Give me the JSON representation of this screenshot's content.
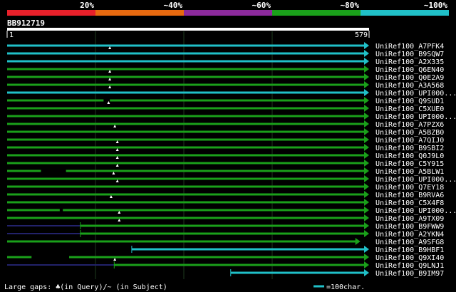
{
  "chart_data": {
    "type": "bar",
    "query_id": "BB912719",
    "query_length": 579,
    "scale_start_label": "1",
    "scale_end_label": "579",
    "identity_scale": [
      {
        "label": "20%",
        "color": "#e8202a"
      },
      {
        "label": "~40%",
        "color": "#e86a10"
      },
      {
        "label": "~60%",
        "color": "#8c2a9c"
      },
      {
        "label": "~80%",
        "color": "#1aa01a"
      },
      {
        "label": "~100%",
        "color": "#20c0c8"
      }
    ],
    "hits": [
      {
        "name": "UniRef100_A7PFK4",
        "color": "#20c0c8",
        "start": 1,
        "end": 579,
        "gap": 165,
        "gap_pos": [
          170,
          172
        ]
      },
      {
        "name": "UniRef100_B9SQW7",
        "color": "#20c0c8",
        "start": 1,
        "end": 579,
        "gap": null
      },
      {
        "name": "UniRef100_A2X335",
        "color": "#20c0c8",
        "start": 1,
        "end": 579,
        "gap": null
      },
      {
        "name": "UniRef100_Q6EN40",
        "color": "#1aa01a",
        "start": 1,
        "end": 579,
        "gap": 165
      },
      {
        "name": "UniRef100_Q0E2A9",
        "color": "#1aa01a",
        "start": 1,
        "end": 579,
        "gap": 165
      },
      {
        "name": "UniRef100_A3A568",
        "color": "#1aa01a",
        "start": 1,
        "end": 579,
        "gap": 165
      },
      {
        "name": "UniRef100_UPI000...",
        "color": "#20c0c8",
        "start": 1,
        "end": 579,
        "gap": null
      },
      {
        "name": "UniRef100_Q9SUD1",
        "color": "#1aa01a",
        "start": 1,
        "end": 579,
        "gap": 163,
        "black": [
          155,
          165
        ]
      },
      {
        "name": "UniRef100_C5XUE0",
        "color": "#1aa01a",
        "start": 1,
        "end": 579,
        "gap": null
      },
      {
        "name": "UniRef100_UPI000...",
        "color": "#1aa01a",
        "start": 1,
        "end": 579,
        "gap": null
      },
      {
        "name": "UniRef100_A7PZX6",
        "color": "#1aa01a",
        "start": 1,
        "end": 579,
        "gap": 173
      },
      {
        "name": "UniRef100_A5BZB0",
        "color": "#1aa01a",
        "start": 1,
        "end": 579,
        "gap": null
      },
      {
        "name": "UniRef100_A7QIJ0",
        "color": "#1aa01a",
        "start": 1,
        "end": 579,
        "gap": 177
      },
      {
        "name": "UniRef100_B9SBI2",
        "color": "#1aa01a",
        "start": 1,
        "end": 579,
        "gap": 177
      },
      {
        "name": "UniRef100_Q0J9L0",
        "color": "#1aa01a",
        "start": 1,
        "end": 579,
        "gap": 177
      },
      {
        "name": "UniRef100_C5Y915",
        "color": "#1aa01a",
        "start": 1,
        "end": 579,
        "gap": 177
      },
      {
        "name": "UniRef100_A5BLW1",
        "color": "#1aa01a",
        "start": 1,
        "end": 579,
        "gap": 171,
        "black": [
          55,
          95
        ]
      },
      {
        "name": "UniRef100_UPI000...",
        "color": "#1aa01a",
        "start": 1,
        "end": 579,
        "gap": 177
      },
      {
        "name": "UniRef100_Q7EY18",
        "color": "#1aa01a",
        "start": 1,
        "end": 579,
        "gap": null
      },
      {
        "name": "UniRef100_B9RVA6",
        "color": "#1aa01a",
        "start": 1,
        "end": 579,
        "gap": 167
      },
      {
        "name": "UniRef100_C5X4F8",
        "color": "#1aa01a",
        "start": 1,
        "end": 579,
        "gap": null
      },
      {
        "name": "UniRef100_UPI000...",
        "color": "#1aa01a",
        "start": 1,
        "end": 579,
        "gap": 180,
        "black": [
          85,
          90
        ]
      },
      {
        "name": "UniRef100_A9TX09",
        "color": "#1aa01a",
        "start": 1,
        "end": 579,
        "gap": 180
      },
      {
        "name": "UniRef100_B9FWW9",
        "color": "#1aa01a",
        "start": 118,
        "end": 579,
        "gap": null,
        "navy": [
          1,
          118
        ]
      },
      {
        "name": "UniRef100_A2YKN4",
        "color": "#1aa01a",
        "start": 118,
        "end": 579,
        "gap": null,
        "navy": [
          1,
          118
        ]
      },
      {
        "name": "UniRef100_A9SFG8",
        "color": "#1aa01a",
        "start": 1,
        "end": 565,
        "gap": null
      },
      {
        "name": "UniRef100_B9HBF1",
        "color": "#20c0c8",
        "start": 200,
        "end": 579,
        "gap": null
      },
      {
        "name": "UniRef100_Q9XI40",
        "color": "#1aa01a",
        "start": 1,
        "end": 579,
        "gap": 173,
        "black": [
          40,
          100
        ]
      },
      {
        "name": "UniRef100_Q9LNJ1",
        "color": "#1aa01a",
        "start": 172,
        "end": 579,
        "gap": null,
        "navy": [
          1,
          172
        ]
      },
      {
        "name": "UniRef100_B9IM97",
        "color": "#20c0c8",
        "start": 358,
        "end": 579,
        "gap": null
      }
    ],
    "footer_left": "Large gaps: ♣(in Query)/~ (in Subject)",
    "footer_right": "=100char."
  }
}
